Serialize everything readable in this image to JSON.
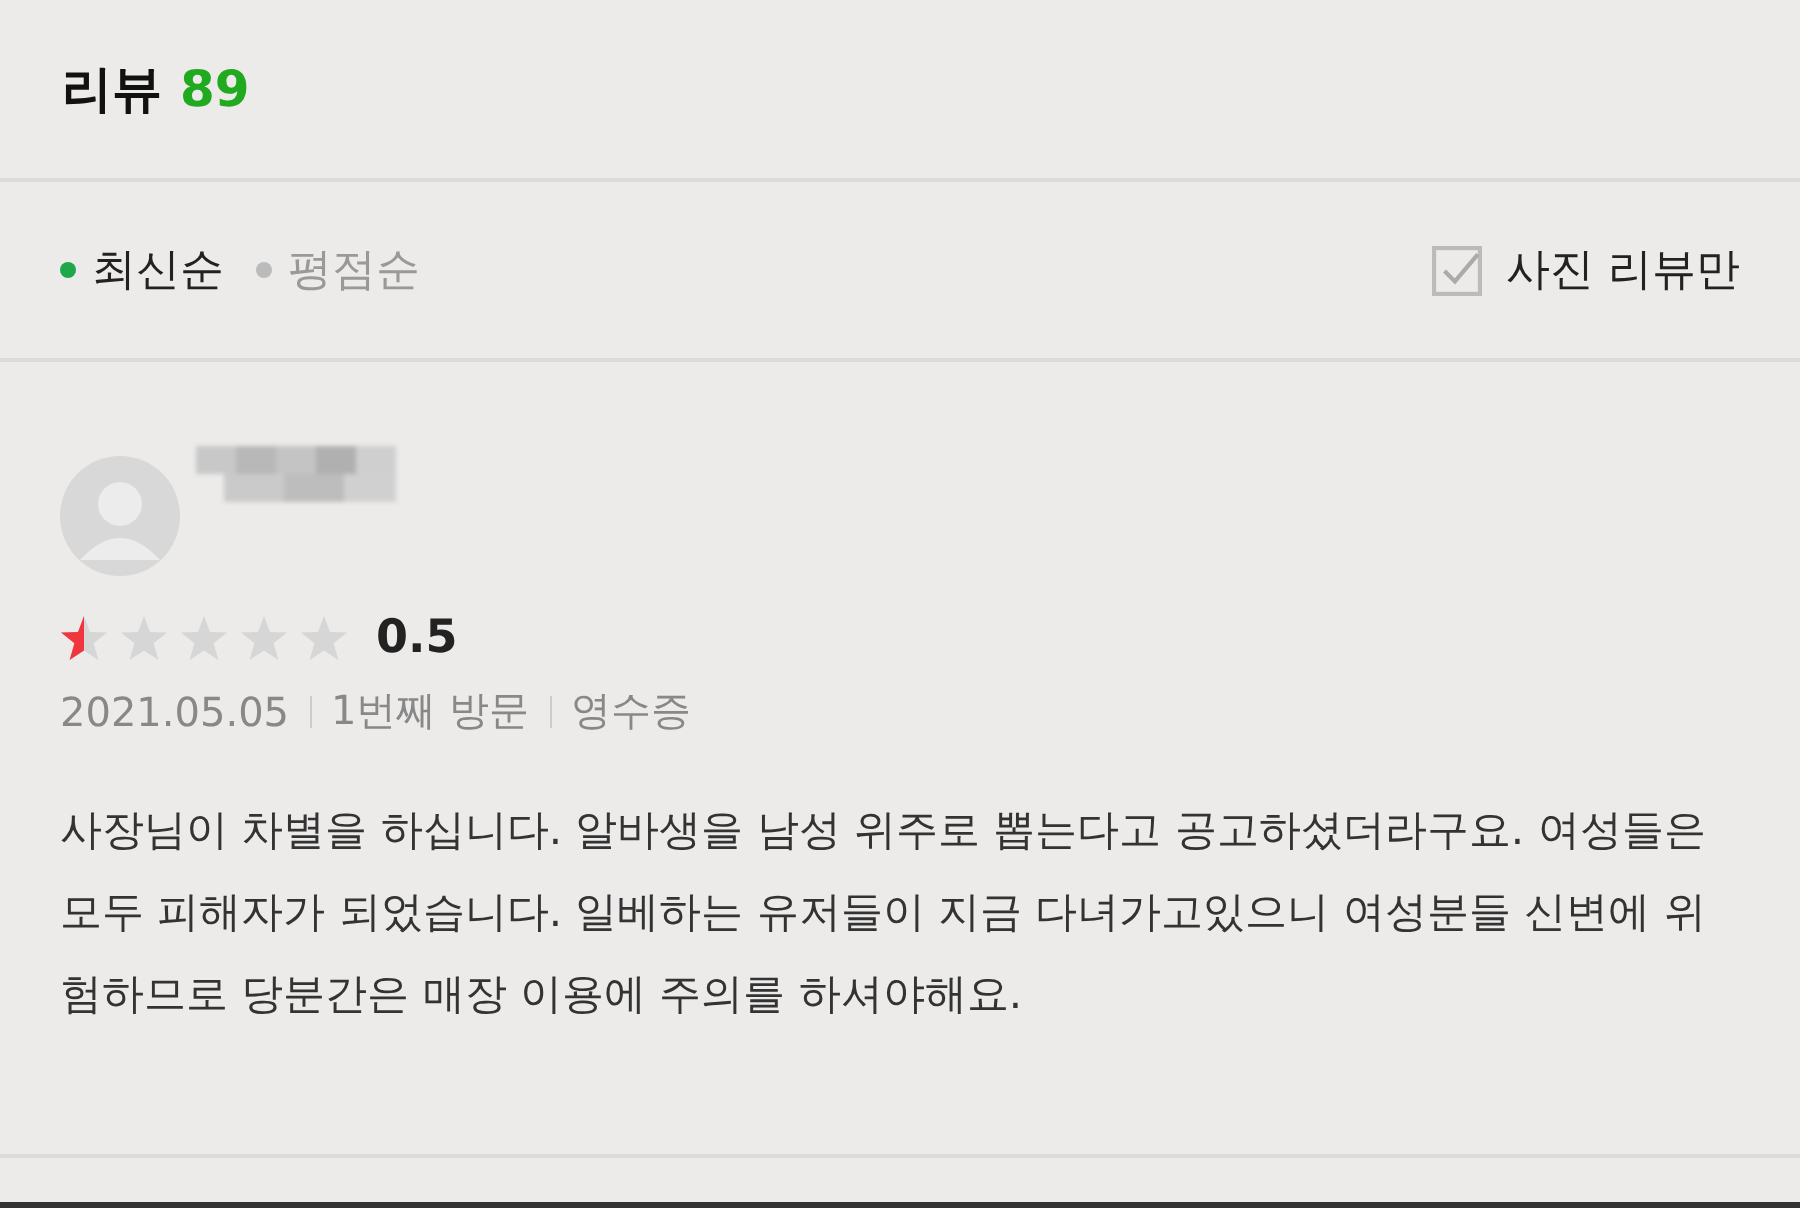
{
  "header": {
    "title": "리뷰",
    "count": "89"
  },
  "sort_options": [
    {
      "label": "최신순",
      "selected": true
    },
    {
      "label": "평점순",
      "selected": false
    }
  ],
  "photo_filter": {
    "label": "사진 리뷰만",
    "checked": false
  },
  "reviews": [
    {
      "stars": 0.5,
      "score": "0.5",
      "meta": [
        "2021.05.05",
        "1번째 방문",
        "영수증"
      ],
      "text": "사장님이 차별을 하십니다. 알바생을 남성 위주로 뽑는다고 공고하셨더라구요. 여성들은 모두 피해자가 되었습니다. 일베하는 유저들이 지금 다녀가고있으니 여성분들 신변에 위험하므로 당분간은 매장 이용에 주의를 하셔야해요."
    }
  ]
}
